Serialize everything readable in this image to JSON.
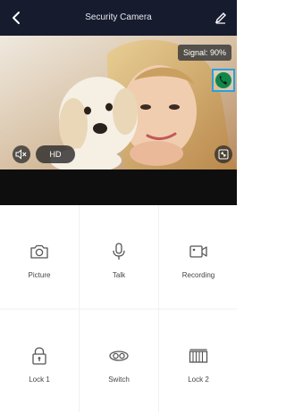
{
  "header": {
    "title": "Security Camera"
  },
  "video": {
    "signal_label": "Signal: 90%",
    "quality_label": "HD"
  },
  "actions": [
    {
      "label": "Picture",
      "icon": "camera-icon"
    },
    {
      "label": "Talk",
      "icon": "microphone-icon"
    },
    {
      "label": "Recording",
      "icon": "video-record-icon"
    },
    {
      "label": "Lock 1",
      "icon": "lock-icon"
    },
    {
      "label": "Switch",
      "icon": "switch-icon"
    },
    {
      "label": "Lock 2",
      "icon": "gate-icon"
    }
  ],
  "colors": {
    "header_bg": "#161b2e",
    "call_border": "#2aa0e0",
    "call_fill": "#11864a"
  }
}
